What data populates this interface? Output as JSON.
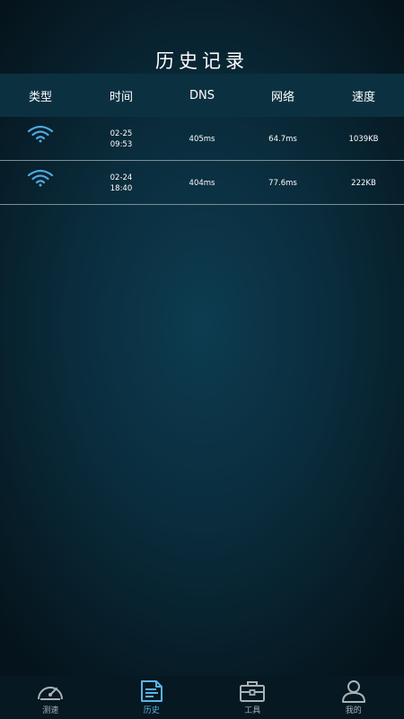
{
  "page_title": "历史记录",
  "table": {
    "headers": [
      "类型",
      "时间",
      "DNS",
      "网络",
      "速度"
    ],
    "rows": [
      {
        "type_icon": "wifi-icon",
        "date": "02-25",
        "time": "09:53",
        "dns": "405ms",
        "network": "64.7ms",
        "speed": "1039KB"
      },
      {
        "type_icon": "wifi-icon",
        "date": "02-24",
        "time": "18:40",
        "dns": "404ms",
        "network": "77.6ms",
        "speed": "222KB"
      }
    ]
  },
  "tabbar": {
    "items": [
      {
        "label": "测速",
        "icon": "speedometer-icon",
        "active": false
      },
      {
        "label": "历史",
        "icon": "history-document-icon",
        "active": true
      },
      {
        "label": "工具",
        "icon": "toolbox-icon",
        "active": false
      },
      {
        "label": "我的",
        "icon": "user-icon",
        "active": false
      }
    ]
  },
  "colors": {
    "accent": "#5ab3e8",
    "wifi": "#4fa8dd",
    "header_bg": "#0b3141",
    "background": "#0a2d3d",
    "divider": "#7c8e95"
  }
}
